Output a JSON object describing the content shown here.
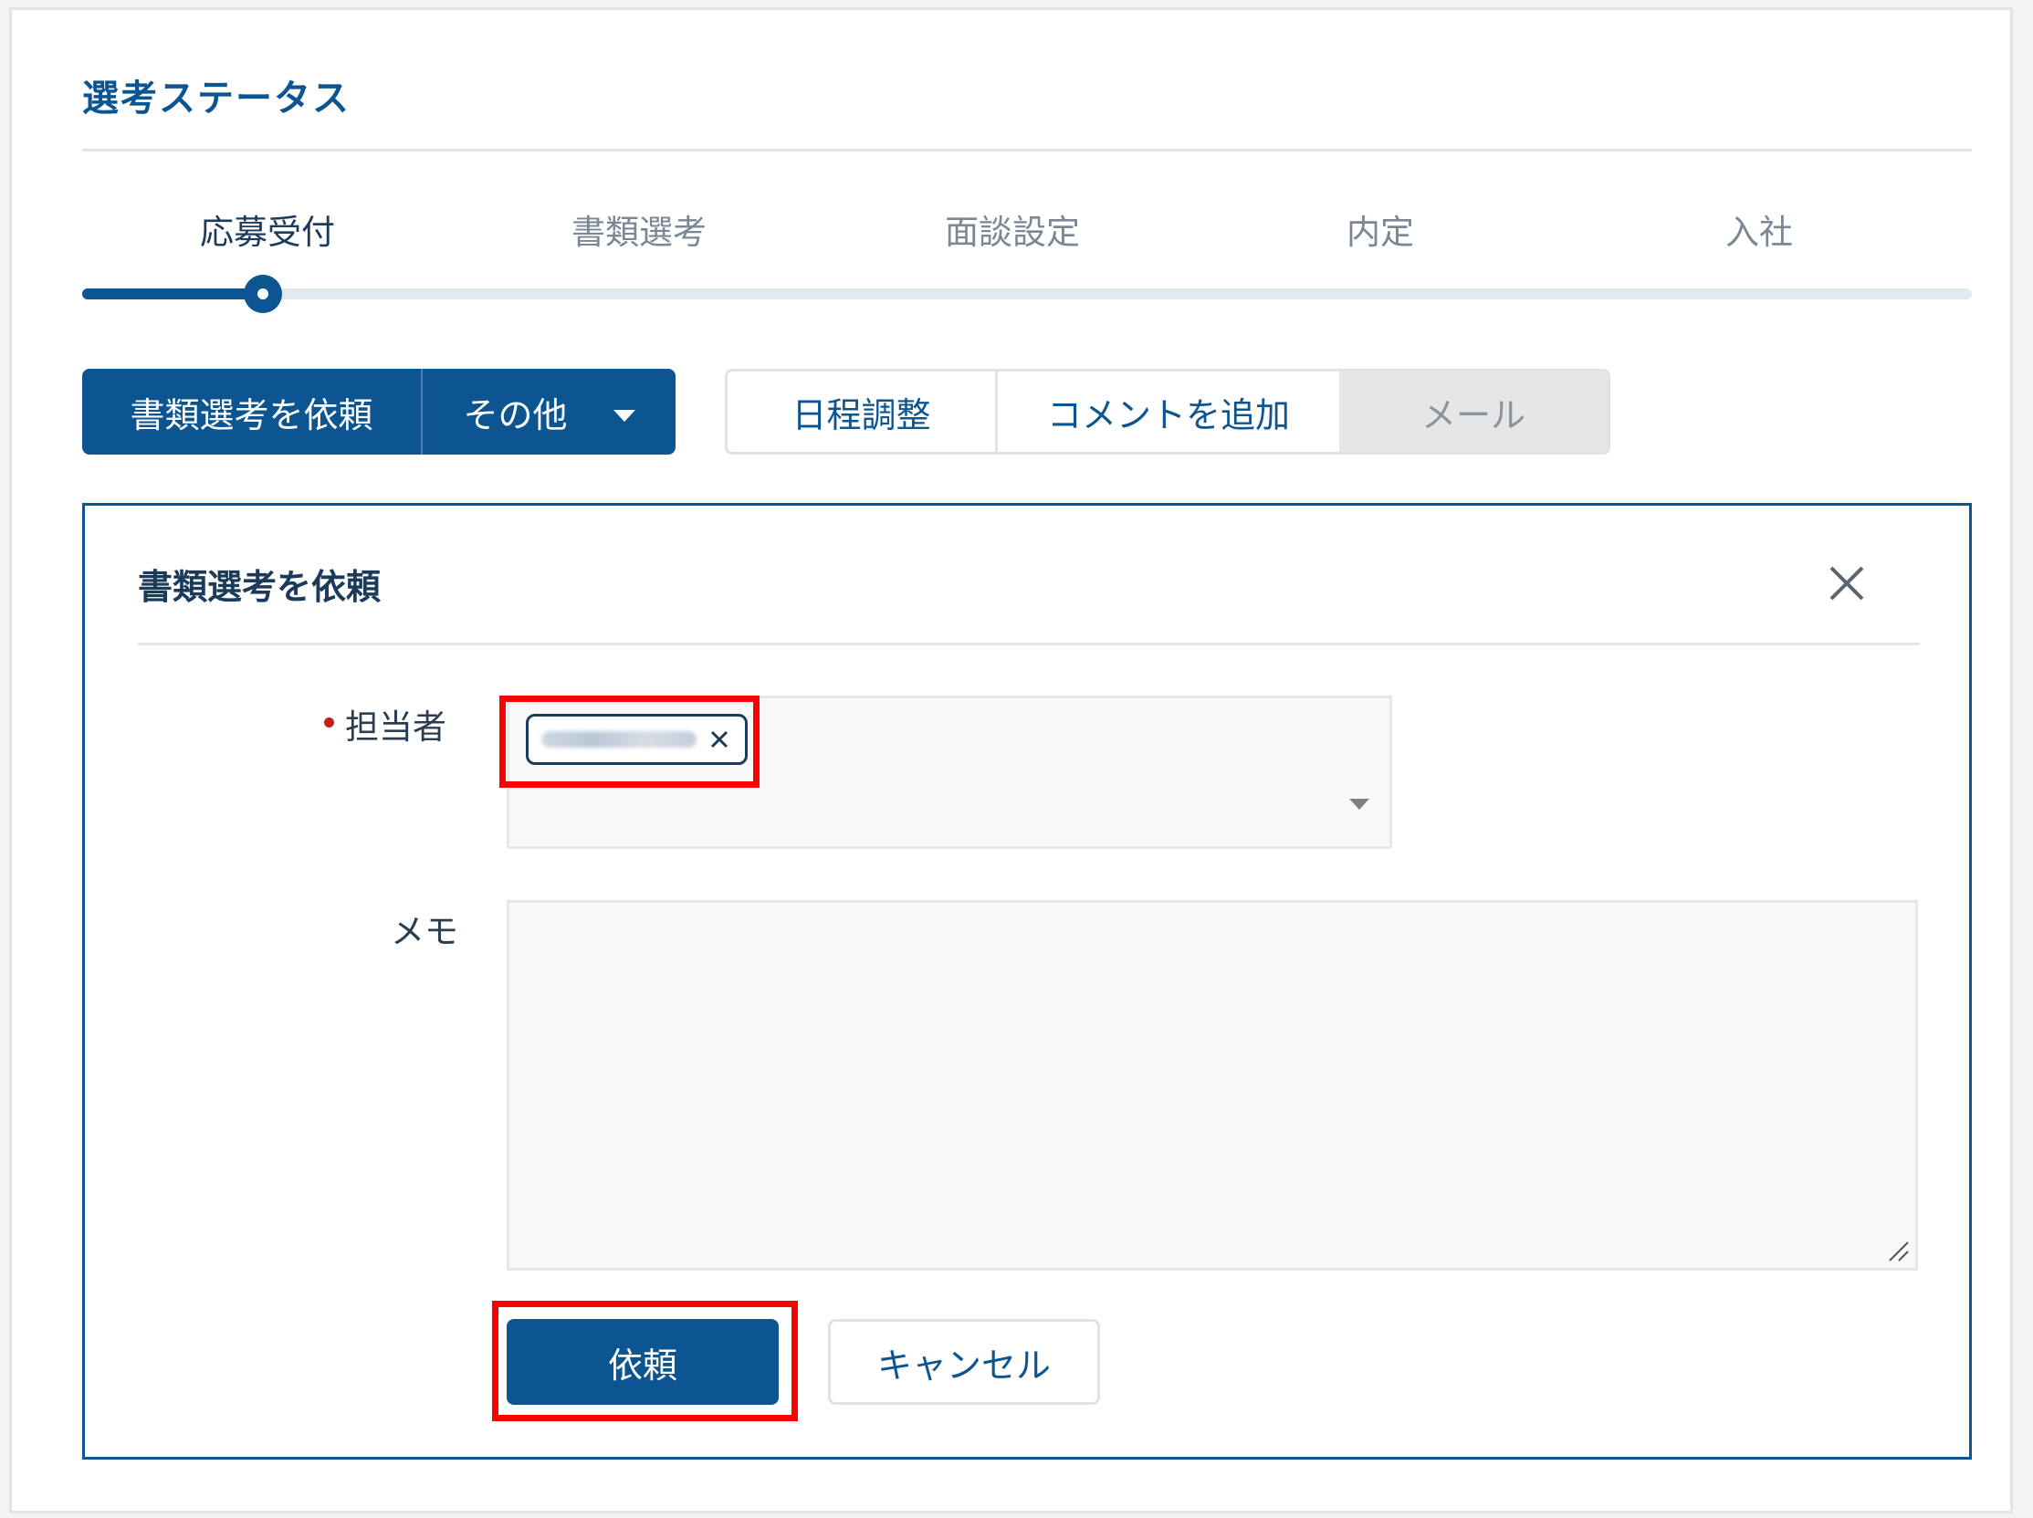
{
  "section_title": "選考ステータス",
  "steps": [
    {
      "label": "応募受付",
      "active": true
    },
    {
      "label": "書類選考",
      "active": false
    },
    {
      "label": "面談設定",
      "active": false
    },
    {
      "label": "内定",
      "active": false
    },
    {
      "label": "入社",
      "active": false
    }
  ],
  "progress": {
    "current_step_index": 0
  },
  "actions": {
    "primary_label": "書類選考を依頼",
    "other_label": "その他",
    "schedule_label": "日程調整",
    "comment_label": "コメントを追加",
    "mail_label": "メール"
  },
  "panel": {
    "title": "書類選考を依頼",
    "assignee_label": "担当者",
    "memo_label": "メモ",
    "submit_label": "依頼",
    "cancel_label": "キャンセル"
  },
  "colors": {
    "accent": "#0d5591",
    "required": "#c81d1d",
    "highlight": "#ff0000"
  }
}
